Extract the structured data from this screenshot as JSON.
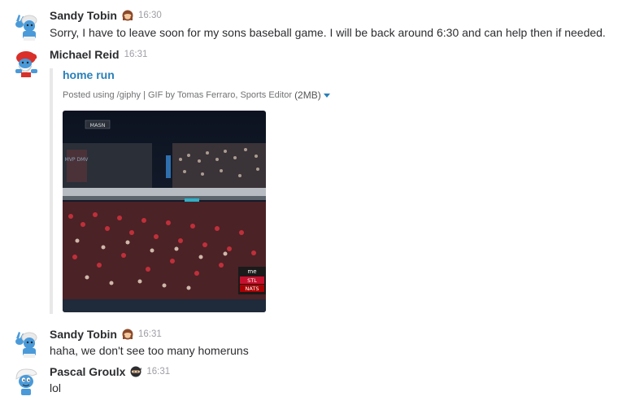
{
  "messages": [
    {
      "author": "Sandy Tobin",
      "status_emoji": "woman-emoji",
      "time": "16:30",
      "text": "Sorry, I have to leave soon for my sons baseball game.  I will be back around 6:30 and can help then if needed."
    },
    {
      "author": "Michael Reid",
      "time": "16:31",
      "attachment": {
        "title": "home run",
        "posted_using": "Posted using /giphy | GIF by Tomas Ferraro, Sports Editor",
        "size": "(2MB)",
        "image_icon": "gif-baseball-stadium",
        "overlay_labels": {
          "network": "MASN",
          "board": "MVP DMV",
          "score_top": "me",
          "score_team1": "STL",
          "score_team2": "NATS"
        }
      }
    },
    {
      "author": "Sandy Tobin",
      "status_emoji": "woman-emoji",
      "time": "16:31",
      "text": "haha, we don't see too many homeruns"
    },
    {
      "author": "Pascal Groulx",
      "status_emoji": "ninja-emoji",
      "time": "16:31",
      "text": "lol"
    }
  ],
  "colors": {
    "link": "#2a80b9",
    "timestamp": "#9e9ea6",
    "attachment_border": "#e8e8e8"
  }
}
